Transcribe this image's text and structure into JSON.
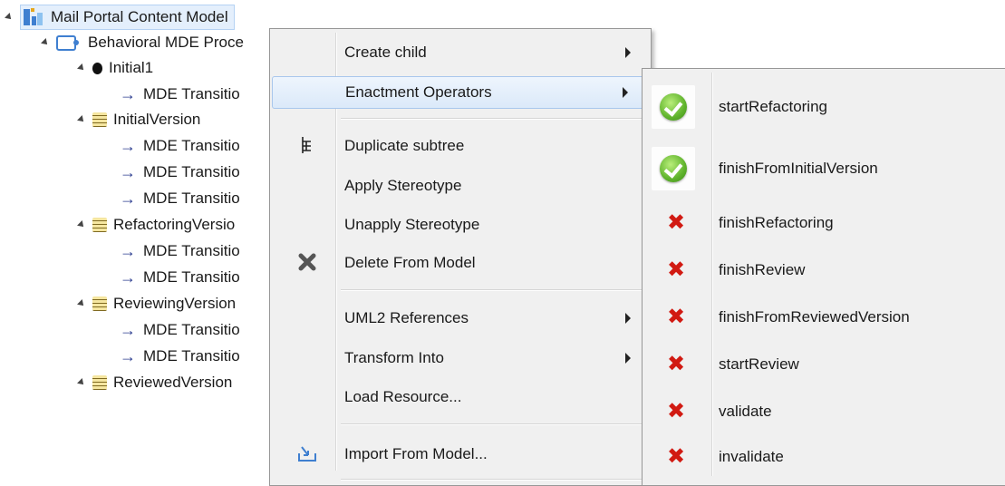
{
  "tree": {
    "root_label": "Mail Portal Content Model",
    "items": [
      {
        "label": "Behavioral MDE Proce",
        "icon": "process-icon"
      },
      {
        "label": "Initial1",
        "icon": "initial-node-icon"
      },
      {
        "label": "MDE Transitio",
        "icon": "arrow-right-icon"
      },
      {
        "label": "InitialVersion",
        "icon": "stereotype-icon"
      },
      {
        "label": "MDE Transitio",
        "icon": "arrow-right-icon"
      },
      {
        "label": "MDE Transitio",
        "icon": "arrow-right-icon"
      },
      {
        "label": "MDE Transitio",
        "icon": "arrow-right-icon"
      },
      {
        "label": "RefactoringVersio",
        "icon": "stereotype-icon"
      },
      {
        "label": "MDE Transitio",
        "icon": "arrow-right-icon"
      },
      {
        "label": "MDE Transitio",
        "icon": "arrow-right-icon"
      },
      {
        "label": "ReviewingVersion",
        "icon": "stereotype-icon"
      },
      {
        "label": "MDE Transitio",
        "icon": "arrow-right-icon"
      },
      {
        "label": "MDE Transitio",
        "icon": "arrow-right-icon"
      },
      {
        "label": "ReviewedVersion",
        "icon": "stereotype-icon"
      }
    ],
    "arrow_glyph": "→"
  },
  "context_menu": {
    "items": [
      {
        "label": "Create child",
        "submenu": true
      },
      {
        "label": "Enactment Operators",
        "submenu": true,
        "highlighted": true
      },
      {
        "label": "Duplicate subtree",
        "icon": "duplicate-subtree-icon"
      },
      {
        "label": "Apply Stereotype"
      },
      {
        "label": "Unapply Stereotype"
      },
      {
        "label": "Delete From Model",
        "icon": "delete-icon"
      },
      {
        "label": "UML2 References",
        "submenu": true
      },
      {
        "label": "Transform Into",
        "submenu": true
      },
      {
        "label": "Load Resource..."
      },
      {
        "label": "Import From Model...",
        "icon": "import-icon"
      }
    ]
  },
  "submenu": {
    "items": [
      {
        "label": "startRefactoring",
        "status": "enabled",
        "icon": "green-check-icon"
      },
      {
        "label": "finishFromInitialVersion",
        "status": "enabled",
        "icon": "green-check-icon"
      },
      {
        "label": "finishRefactoring",
        "status": "disabled",
        "icon": "red-x-icon"
      },
      {
        "label": "finishReview",
        "status": "disabled",
        "icon": "red-x-icon"
      },
      {
        "label": "finishFromReviewedVersion",
        "status": "disabled",
        "icon": "red-x-icon"
      },
      {
        "label": "startReview",
        "status": "disabled",
        "icon": "red-x-icon"
      },
      {
        "label": "validate",
        "status": "disabled",
        "icon": "red-x-icon"
      },
      {
        "label": "invalidate",
        "status": "disabled",
        "icon": "red-x-icon"
      }
    ],
    "x_glyph": "✖"
  },
  "colors": {
    "menu_bg": "#f0f0f0",
    "highlight": "#dbe9f9",
    "check_green": "#5fb32c",
    "x_red": "#d11a12"
  }
}
